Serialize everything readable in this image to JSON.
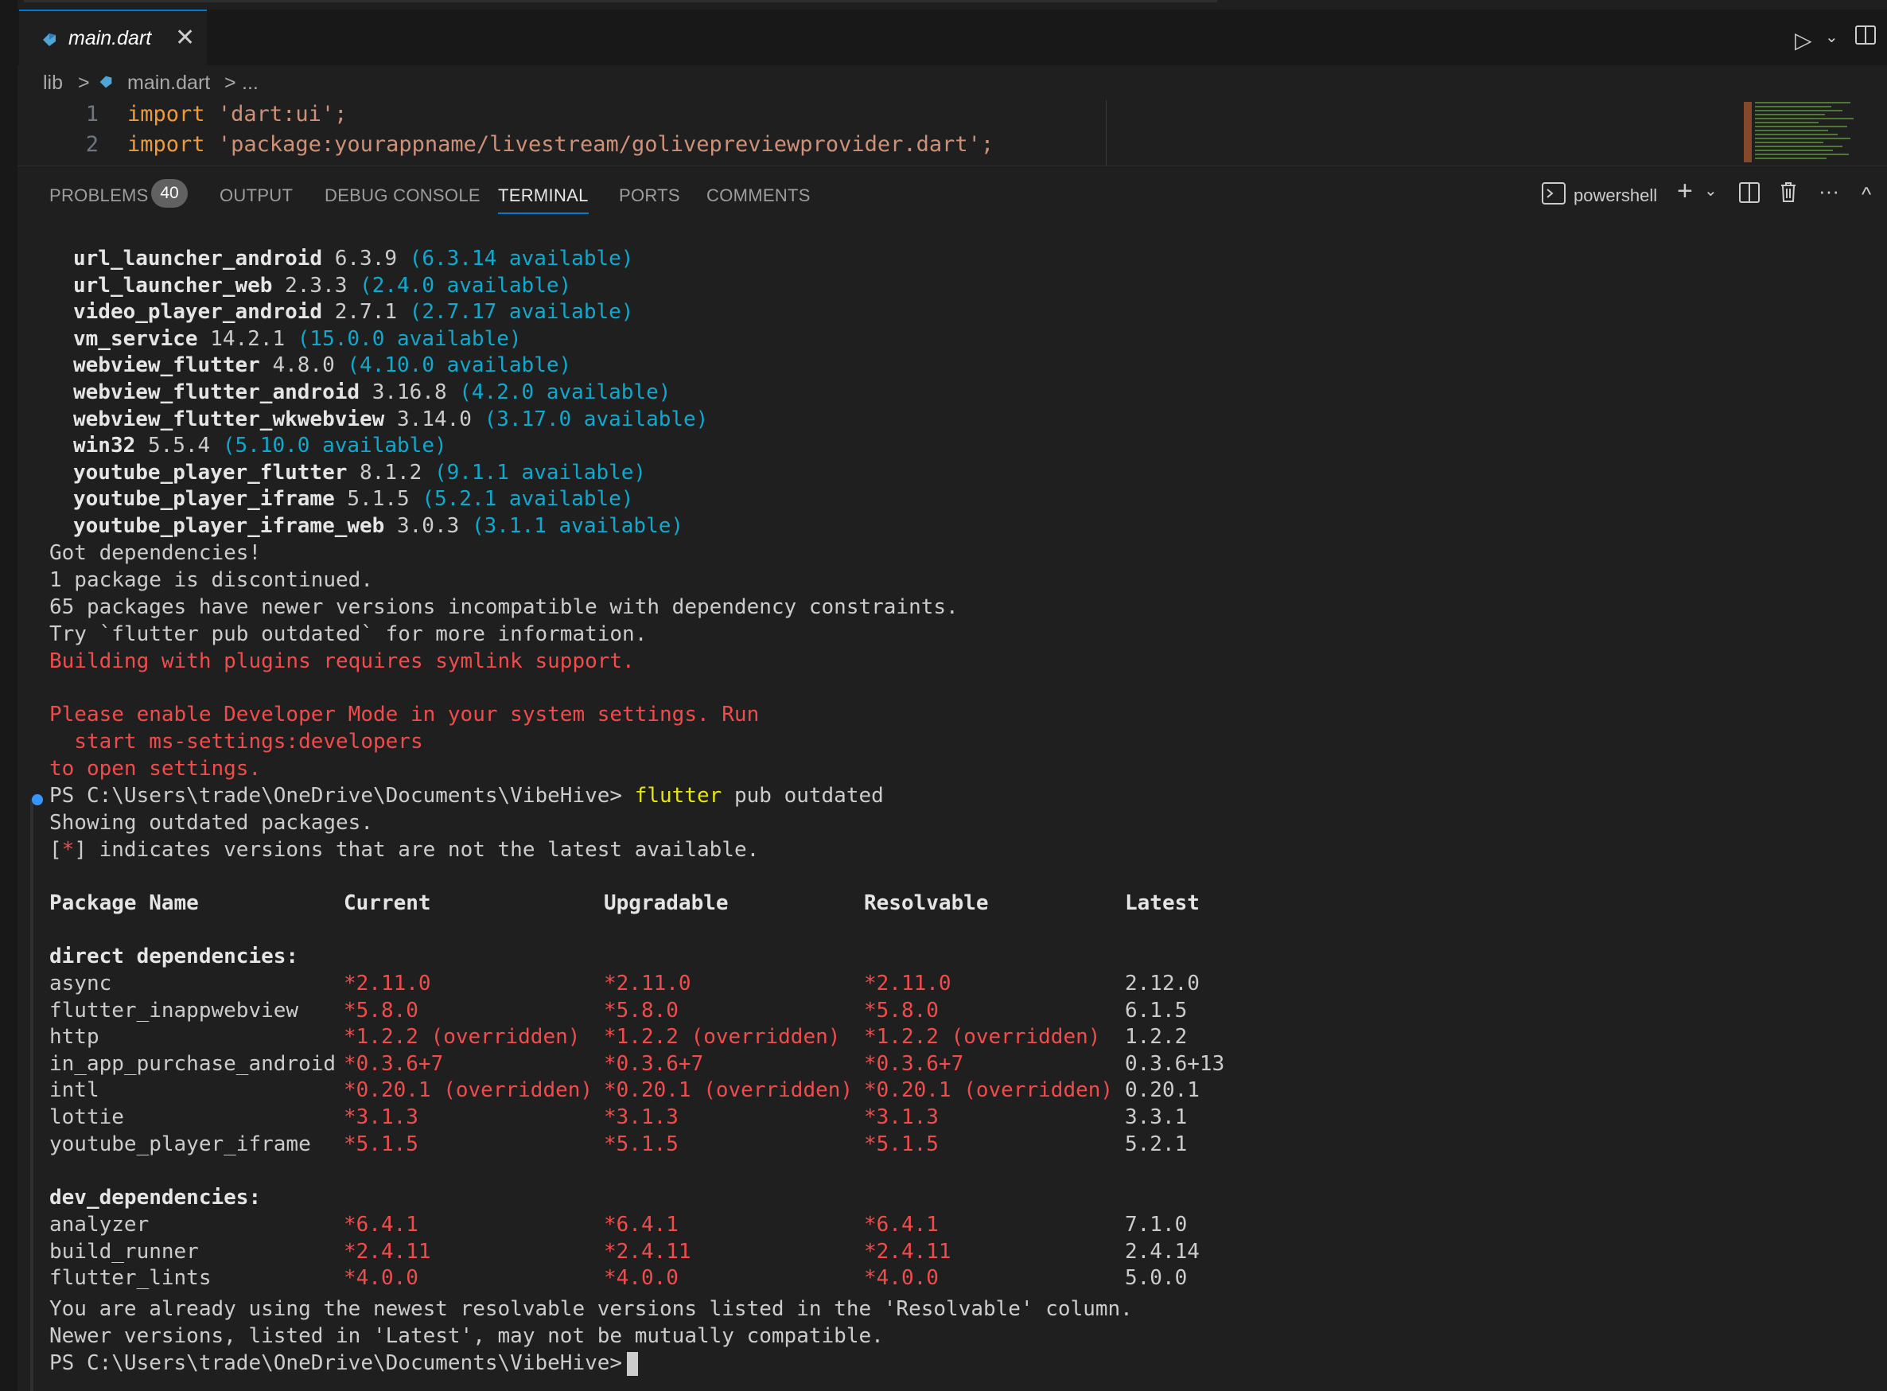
{
  "tab": {
    "filename": "main.dart",
    "close_glyph": "✕"
  },
  "breadcrumb": {
    "folder": "lib",
    "sep": ">",
    "file": "main.dart",
    "sep2": ">",
    "ellipsis": "..."
  },
  "editor": {
    "lines": [
      {
        "num": "1",
        "keyword": "import",
        "string": "'dart:ui';"
      },
      {
        "num": "2",
        "keyword": "import",
        "string": "'package:yourappname/livestream/golivepreviewprovider.dart';"
      }
    ]
  },
  "panel": {
    "tabs": [
      "PROBLEMS",
      "OUTPUT",
      "DEBUG CONSOLE",
      "TERMINAL",
      "PORTS",
      "COMMENTS"
    ],
    "problems_count": "40",
    "shell": "powershell",
    "plus": "+",
    "chev": "⌄",
    "more": "···",
    "collapse": "^"
  },
  "terminal": {
    "deps": [
      {
        "name": "url_launcher_android",
        "ver": "6.3.9",
        "avail": "(6.3.14 available)"
      },
      {
        "name": "url_launcher_web",
        "ver": "2.3.3",
        "avail": "(2.4.0 available)"
      },
      {
        "name": "video_player_android",
        "ver": "2.7.1",
        "avail": "(2.7.17 available)"
      },
      {
        "name": "vm_service",
        "ver": "14.2.1",
        "avail": "(15.0.0 available)"
      },
      {
        "name": "webview_flutter",
        "ver": "4.8.0",
        "avail": "(4.10.0 available)"
      },
      {
        "name": "webview_flutter_android",
        "ver": "3.16.8",
        "avail": "(4.2.0 available)"
      },
      {
        "name": "webview_flutter_wkwebview",
        "ver": "3.14.0",
        "avail": "(3.17.0 available)"
      },
      {
        "name": "win32",
        "ver": "5.5.4",
        "avail": "(5.10.0 available)"
      },
      {
        "name": "youtube_player_flutter",
        "ver": "8.1.2",
        "avail": "(9.1.1 available)"
      },
      {
        "name": "youtube_player_iframe",
        "ver": "5.1.5",
        "avail": "(5.2.1 available)"
      },
      {
        "name": "youtube_player_iframe_web",
        "ver": "3.0.3",
        "avail": "(3.1.1 available)"
      }
    ],
    "got": "Got dependencies!",
    "discontinued": "1 package is discontinued.",
    "incompatible": "65 packages have newer versions incompatible with dependency constraints.",
    "try": "Try `flutter pub outdated` for more information.",
    "symlink": "Building with plugins requires symlink support.",
    "dev_mode": "Please enable Developer Mode in your system settings. Run",
    "start_cmd": "  start ms-settings:developers",
    "to_open": "to open settings.",
    "prompt": "PS C:\\Users\\trade\\OneDrive\\Documents\\VibeHive>",
    "cmd_flutter": "flutter",
    "cmd_rest": "pub outdated",
    "showing": "Showing outdated packages.",
    "legend_open": "[",
    "legend_star": "*",
    "legend_rest": "] indicates versions that are not the latest available.",
    "headers": [
      "Package Name",
      "Current",
      "Upgradable",
      "Resolvable",
      "Latest"
    ],
    "direct_label": "direct dependencies:",
    "direct": [
      [
        "async",
        "*2.11.0",
        "*2.11.0",
        "*2.11.0",
        "2.12.0"
      ],
      [
        "flutter_inappwebview",
        "*5.8.0",
        "*5.8.0",
        "*5.8.0",
        "6.1.5"
      ],
      [
        "http",
        "*1.2.2 (overridden)",
        "*1.2.2 (overridden)",
        "*1.2.2 (overridden)",
        "1.2.2"
      ],
      [
        "in_app_purchase_android",
        "*0.3.6+7",
        "*0.3.6+7",
        "*0.3.6+7",
        "0.3.6+13"
      ],
      [
        "intl",
        "*0.20.1 (overridden)",
        "*0.20.1 (overridden)",
        "*0.20.1 (overridden)",
        "0.20.1"
      ],
      [
        "lottie",
        "*3.1.3",
        "*3.1.3",
        "*3.1.3",
        "3.3.1"
      ],
      [
        "youtube_player_iframe",
        "*5.1.5",
        "*5.1.5",
        "*5.1.5",
        "5.2.1"
      ]
    ],
    "dev_label": "dev_dependencies:",
    "dev": [
      [
        "analyzer",
        "*6.4.1",
        "*6.4.1",
        "*6.4.1",
        "7.1.0"
      ],
      [
        "build_runner",
        "*2.4.11",
        "*2.4.11",
        "*2.4.11",
        "2.4.14"
      ],
      [
        "flutter_lints",
        "*4.0.0",
        "*4.0.0",
        "*4.0.0",
        "5.0.0"
      ]
    ],
    "already": "You are already using the newest resolvable versions listed in the 'Resolvable' column.",
    "newer": "Newer versions, listed in 'Latest', may not be mutually compatible."
  },
  "colors": {
    "accent": "#0078d4",
    "cyan": "#11a8cd",
    "red": "#f14c4c",
    "yellow": "#e5e510"
  }
}
